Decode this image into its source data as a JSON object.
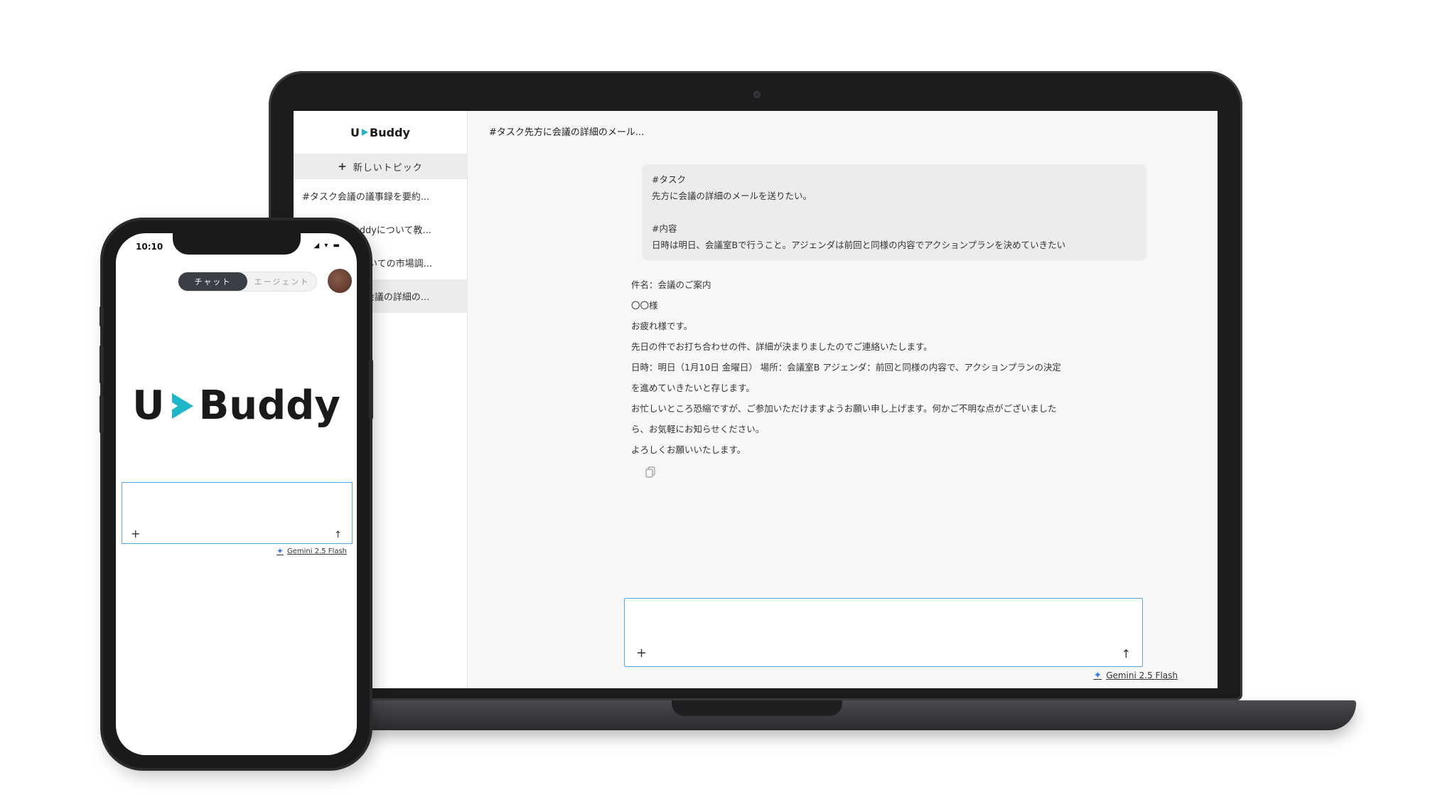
{
  "brand": {
    "logo_u": "U",
    "logo_name": "Buddy",
    "accent": "#1fb6c9"
  },
  "sidebar": {
    "new_topic_label": "新しいトピック",
    "items": [
      {
        "label": "#タスク会議の議事録を要約..."
      },
      {
        "label": "#タスク UBuddyについて教..."
      },
      {
        "label": "#タスク 〜についての市場調..."
      },
      {
        "label": "#タスク先方に会議の詳細の..."
      }
    ]
  },
  "main": {
    "title": "#タスク先方に会議の詳細のメール...",
    "user_message": {
      "line1": "#タスク",
      "line2": "先方に会議の詳細のメールを送りたい。",
      "line3": "#内容",
      "line4": "日時は明日、会議室Bで行うこと。アジェンダは前回と同様の内容でアクションプランを決めていきたい"
    },
    "reply": {
      "subject": "件名：会議のご案内",
      "to": "〇〇様",
      "greeting": "お疲れ様です。",
      "p1": "先日の件でお打ち合わせの件、詳細が決まりましたのでご連絡いたします。",
      "p2a": "日時：明日（1月10日 金曜日） 場所：会議室B アジェンダ：前回と同様の内容で、アクションプランの決定",
      "p2b": "を進めていきたいと存じます。",
      "p3a": "お忙しいところ恐縮ですが、ご参加いただけますようお願い申し上げます。何かご不明な点がございました",
      "p3b": "ら、お気軽にお知らせください。",
      "closing": "よろしくお願いいたします。"
    },
    "model_label": "Gemini 2.5 Flash"
  },
  "phone": {
    "time": "10:10",
    "status_icons": "◢ ▾ ▬",
    "mode_chat": "チャット",
    "mode_agent": "エージェント",
    "model_label": "Gemini 2.5 Flash"
  },
  "icons": {
    "plus": "+",
    "send": "↑",
    "spark": "✦"
  }
}
